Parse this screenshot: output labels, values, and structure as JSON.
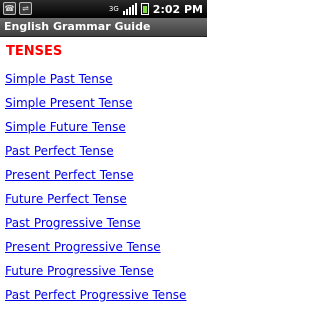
{
  "status_bar": {
    "left_icons": [
      "phone-icon",
      "usb-icon"
    ],
    "network_label": "3G",
    "clock": "2:02 PM"
  },
  "app": {
    "title": "English Grammar Guide"
  },
  "main": {
    "heading": "TENSES",
    "links": [
      "Simple Past Tense",
      "Simple Present Tense",
      "Simple Future Tense",
      "Past Perfect Tense",
      "Present Perfect Tense",
      "Future Perfect Tense",
      "Past Progressive Tense",
      "Present Progressive Tense",
      "Future Progressive Tense",
      "Past Perfect Progressive Tense"
    ]
  },
  "colors": {
    "heading": "#ff0000",
    "link": "#0000ee",
    "titlebar": "#4a4a4a",
    "statusbar": "#000000"
  }
}
